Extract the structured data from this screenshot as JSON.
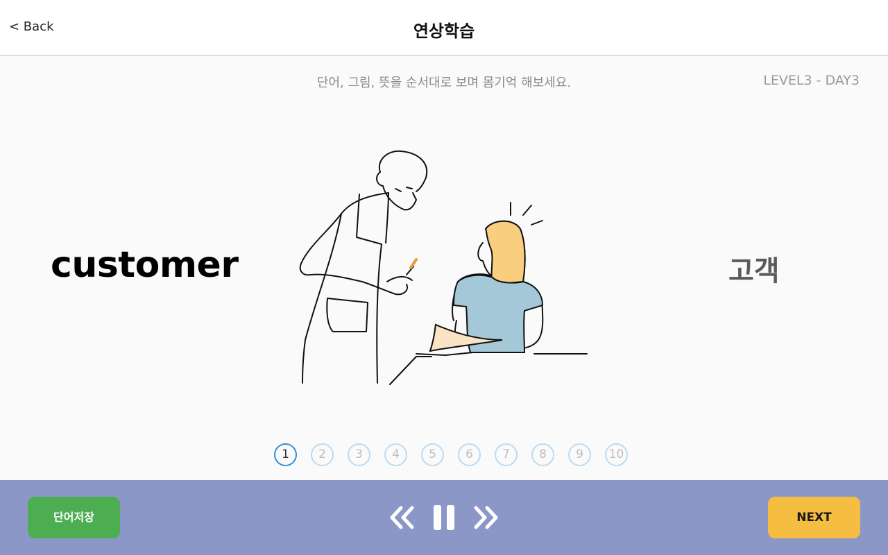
{
  "header": {
    "back_label": "< Back",
    "title": "연상학습"
  },
  "content": {
    "instruction": "단어, 그림, 뜻을 순서대로 보며 몸기억 해보세요.",
    "level": "LEVEL3 - DAY3",
    "word": "customer",
    "meaning": "고객",
    "illustration_icon": "waiter-and-customer-illustration"
  },
  "pager": {
    "items": [
      "1",
      "2",
      "3",
      "4",
      "5",
      "6",
      "7",
      "8",
      "9",
      "10"
    ],
    "current": 1
  },
  "footer": {
    "save_label": "단어저장",
    "next_label": "NEXT",
    "controls": [
      "rewind-icon",
      "pause-icon",
      "fast-forward-icon"
    ]
  },
  "colors": {
    "footer_bg": "#8b98c7",
    "save_button": "#4cae50",
    "next_button": "#f5bd42",
    "pager_active": "#2d8fd6",
    "pager_inactive": "#b9dcf1"
  }
}
